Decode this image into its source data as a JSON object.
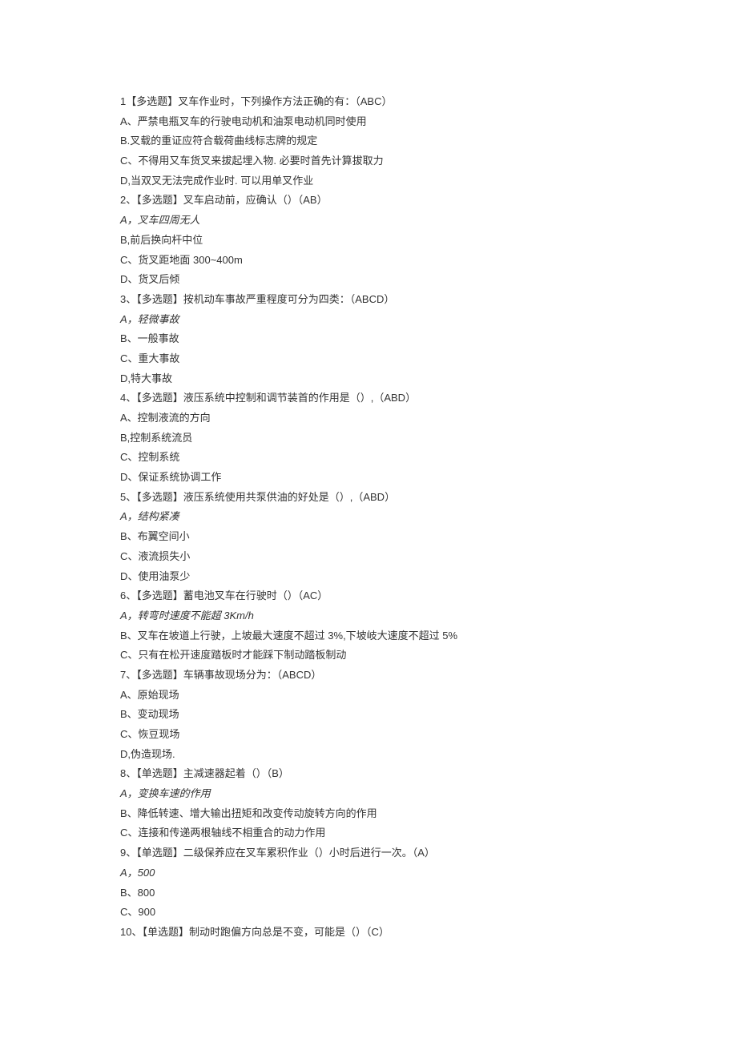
{
  "lines": [
    "1【多选题】叉车作业时，下列操作方法正确的有：（ABC）",
    "A、严禁电瓶叉车的行驶电动机和油泵电动机同时使用",
    "B.叉载的重证应符合载荷曲线标志牌的规定",
    "C、不得用又车货叉来拔起埋入物. 必要时首先计算拔取力",
    "D,当双叉无法完成作业时. 可以用单叉作业",
    "2、【多选题】叉车启动前，应确认（）（AB）",
    {
      "text": "A，叉车四周无人",
      "style": "italic"
    },
    "B,前后换向杆中位",
    "C、货叉距地面 300~400m",
    "D、货叉后倾",
    "3、【多选题】按机动车事故严重程度可分为四类：（ABCD）",
    {
      "text": "A，轻微事故",
      "style": "italic"
    },
    "B、一般事故",
    "C、重大事故",
    "D,特大事故",
    "4、【多选题】液压系统中控制和调节装首的作用是（）,（ABD）",
    "A、控制液流的方向",
    "B,控制系统流员",
    "C、控制系统",
    "D、保证系统协调工作",
    "5、【多选题】液压系统使用共泵供油的好处是（）,（ABD）",
    {
      "text": "A，结构紧凑",
      "style": "italic"
    },
    "B、布翼空间小",
    "C、液流损失小",
    "D、使用油泵少",
    "6、【多选题】蓄电池叉车在行驶时（）（AC）",
    {
      "text": "A，转弯时速度不能超 3Km/h",
      "style": "italic"
    },
    "B、叉车在坡道上行驶，上坡最大速度不超过 3%,下坡岐大速度不超过 5%",
    "C、只有在松开速度踏板时才能踩下制动踏板制动",
    "7、【多选题】车辆事故现场分为：（ABCD）",
    "A、原始现场",
    "B、变动现场",
    "C、恢豆现场",
    "D,伪造现场.",
    "8、【单选题】主减速器起着（）（B）",
    {
      "text": "A，变换车速的作用",
      "style": "italic"
    },
    "B、降低转速、增大输出扭矩和改变传动旋转方向的作用",
    "C、连接和传递两根轴线不相重合的动力作用",
    "9、【单选题】二级保养应在叉车累积作业（）小时后进行一次。（A）",
    {
      "text": "A，500",
      "style": "italic"
    },
    "B、800",
    "C、900",
    "10、【单选题】制动时跑偏方向总是不变，可能是（）（C）"
  ]
}
